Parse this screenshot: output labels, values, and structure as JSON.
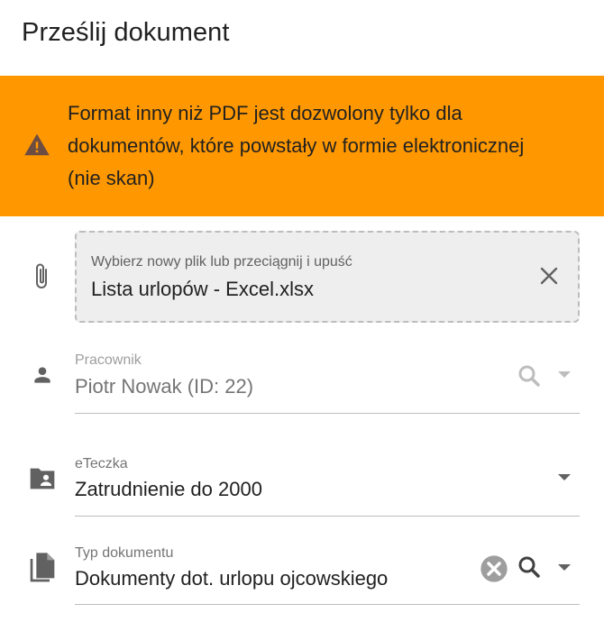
{
  "dialog": {
    "title": "Prześlij dokument"
  },
  "warning": {
    "icon": "warning-icon",
    "color": "#ff9800",
    "lines": [
      "Format inny niż PDF jest dozwolony tylko dla",
      "dokumentów, które powstały w formie elektronicznej",
      "(nie skan)"
    ]
  },
  "file": {
    "icon": "paperclip-icon",
    "hint": "Wybierz nowy plik lub przeciągnij i upuść",
    "name": "Lista urlopów - Excel.xlsx",
    "clear_icon": "close-icon"
  },
  "employee": {
    "icon": "person-icon",
    "label": "Pracownik",
    "value": "Piotr Nowak (ID: 22)",
    "disabled": true
  },
  "folder": {
    "icon": "folder-shared-icon",
    "label": "eTeczka",
    "value": "Zatrudnienie do 2000"
  },
  "doc_type": {
    "icon": "file-copy-icon",
    "label": "Typ dokumentu",
    "value": "Dokumenty dot. urlopu ojcowskiego"
  }
}
